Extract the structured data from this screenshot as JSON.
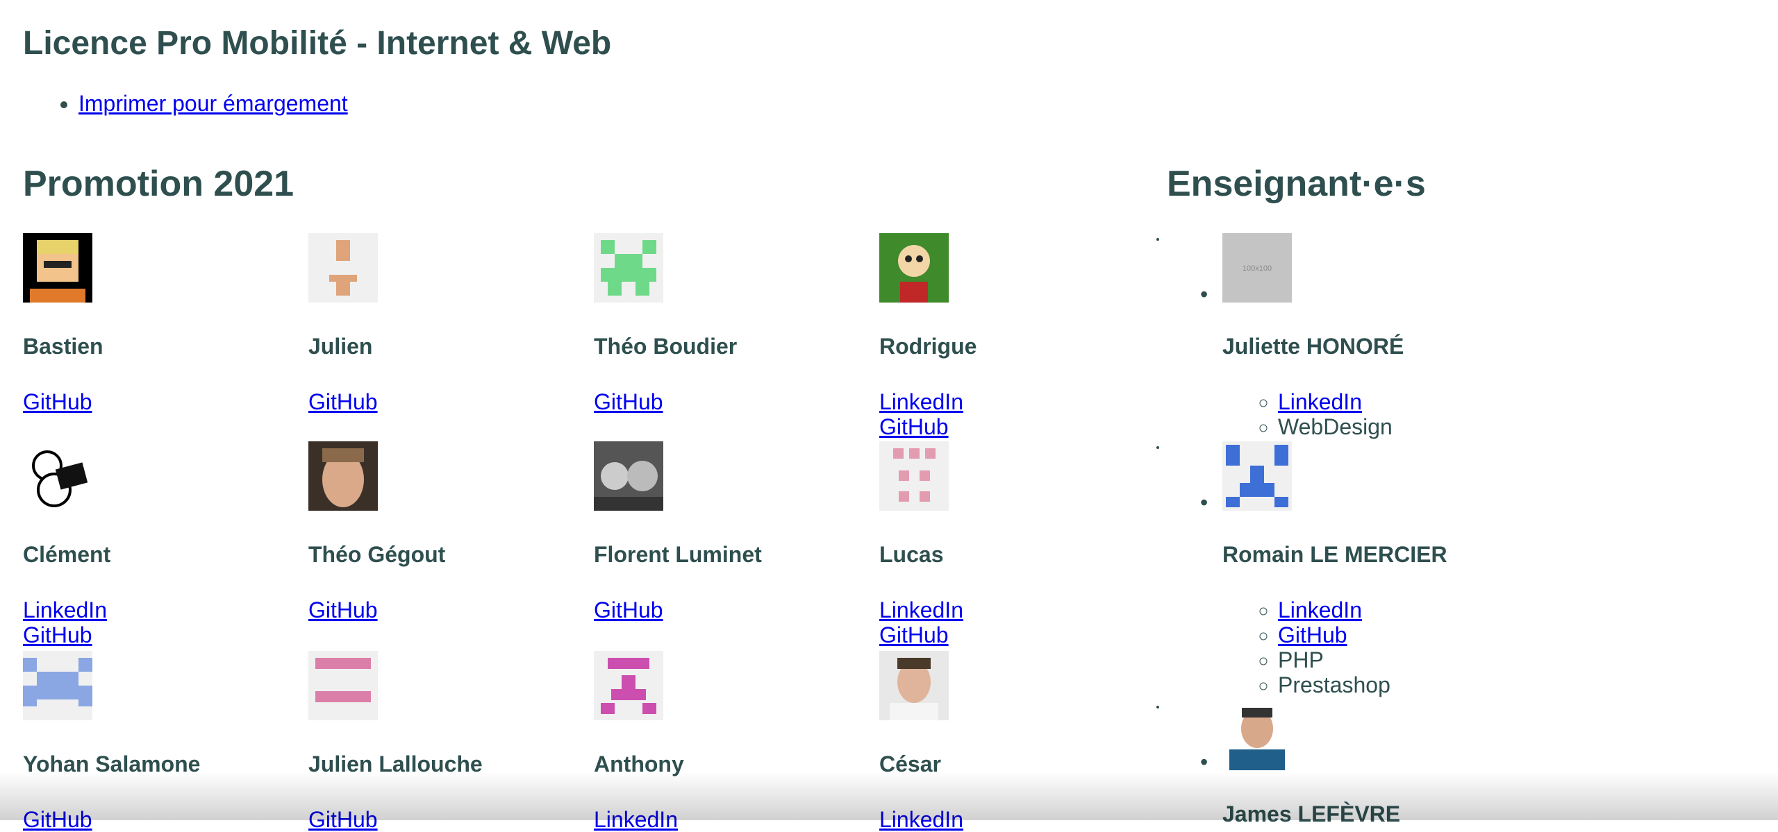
{
  "page": {
    "title": "Licence Pro Mobilité - Internet & Web",
    "print_link": "Imprimer pour émargement"
  },
  "sections": {
    "promotion": "Promotion 2021",
    "teachers": "Enseignant·e·s"
  },
  "students": [
    {
      "name": "Bastien",
      "avatar": "pixel-glasses-avatar",
      "links": [
        "GitHub"
      ]
    },
    {
      "name": "Julien",
      "avatar": "identicon-tan",
      "links": [
        "GitHub"
      ]
    },
    {
      "name": "Théo Boudier",
      "avatar": "identicon-green",
      "links": [
        "GitHub"
      ]
    },
    {
      "name": "Rodrigue",
      "avatar": "cartoon-avatar",
      "links": [
        "LinkedIn",
        "GitHub"
      ]
    },
    {
      "name": "Clément",
      "avatar": "bear-laptop-avatar",
      "links": [
        "LinkedIn",
        "GitHub"
      ]
    },
    {
      "name": "Théo Gégout",
      "avatar": "photo-avatar",
      "links": [
        "GitHub"
      ]
    },
    {
      "name": "Florent Luminet",
      "avatar": "cartoon-bw-avatar",
      "links": [
        "GitHub"
      ]
    },
    {
      "name": "Lucas",
      "avatar": "identicon-pink",
      "links": [
        "LinkedIn",
        "GitHub"
      ]
    },
    {
      "name": "Yohan Salamone",
      "avatar": "identicon-blue",
      "links": [
        "GitHub"
      ]
    },
    {
      "name": "Julien Lallouche",
      "avatar": "identicon-rose",
      "links": [
        "GitHub"
      ]
    },
    {
      "name": "Anthony",
      "avatar": "identicon-magenta",
      "links": [
        "LinkedIn"
      ]
    },
    {
      "name": "César",
      "avatar": "photo-avatar",
      "links": [
        "LinkedIn"
      ]
    }
  ],
  "teachers": [
    {
      "name": "Juliette HONORÉ",
      "avatar_label": "100x100",
      "links": [
        "LinkedIn"
      ],
      "skills": [
        "WebDesign"
      ]
    },
    {
      "name": "Romain LE MERCIER",
      "avatar": "identicon-blue",
      "links": [
        "LinkedIn",
        "GitHub"
      ],
      "skills": [
        "PHP",
        "Prestashop"
      ]
    },
    {
      "name": "James LEFÈVRE",
      "avatar": "photo-avatar",
      "links": [],
      "skills": []
    }
  ],
  "colors": {
    "link": "#0000ee",
    "text": "#2f4f4f",
    "identicon_tan": "#e0a47a",
    "identicon_green": "#6fd98a",
    "identicon_pink": "#e39bb0",
    "identicon_blue": "#8aa6e3",
    "identicon_rose": "#db7fa8",
    "identicon_magenta": "#cc4fb0",
    "identicon_teacher_blue": "#3e6fd6"
  }
}
